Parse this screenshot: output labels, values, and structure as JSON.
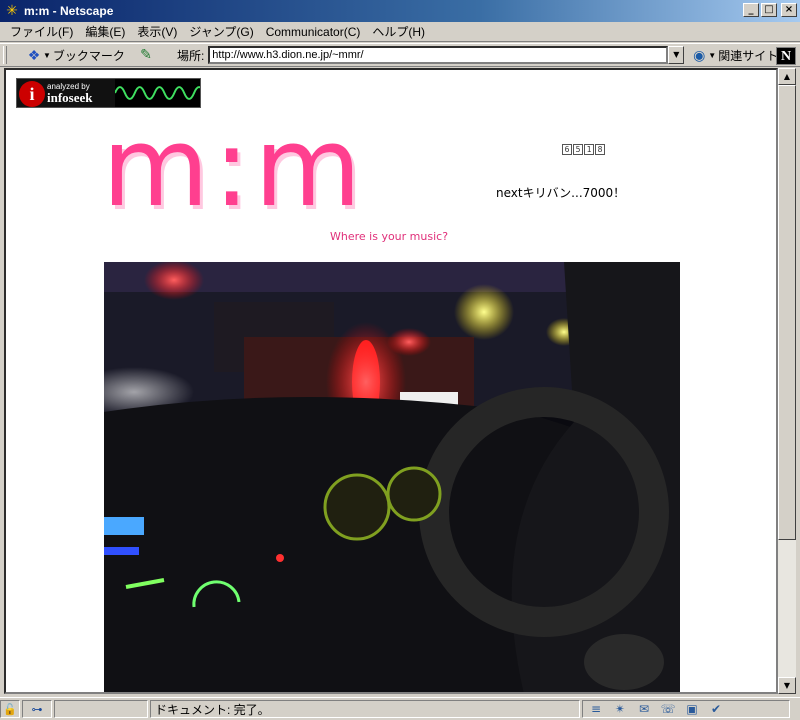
{
  "window": {
    "title": "m:m - Netscape",
    "controls": {
      "minimize": "_",
      "maximize": "□",
      "close": "×"
    }
  },
  "menu": [
    "ファイル(F)",
    "編集(E)",
    "表示(V)",
    "ジャンプ(G)",
    "Communicator(C)",
    "ヘルプ(H)"
  ],
  "toolbar": {
    "bookmarks_label": "ブックマーク",
    "location_label": "場所:",
    "url": "http://www.h3.dion.ne.jp/~mmr/",
    "related_label": "関連サイト",
    "brand_letter": "N"
  },
  "page": {
    "banner_small": "analyzed by",
    "banner_big": "infoseek",
    "banner_i": "i",
    "logo": "m:m",
    "counter_digits": [
      "6",
      "5",
      "1",
      "8"
    ],
    "kiriban": "nextキリバン...7000！",
    "tagline": "Where is your music?"
  },
  "status": {
    "text": "ドキュメント: 完了。"
  },
  "colors": {
    "logo_pink": "#ff3f8f",
    "tagline_pink": "#e0307a",
    "titlebar": "#0a246a"
  }
}
